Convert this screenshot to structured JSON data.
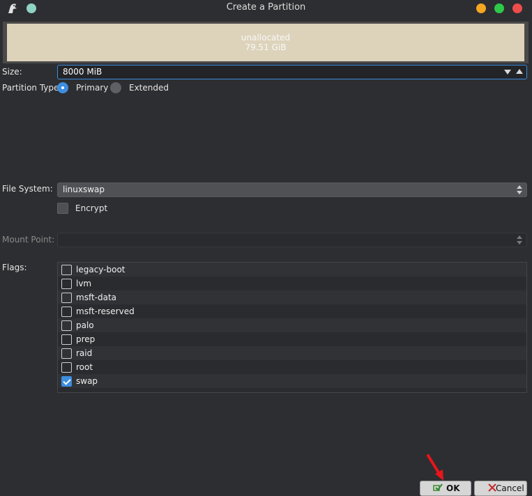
{
  "window": {
    "title": "Create a Partition",
    "controls": [
      "minimize",
      "maximize",
      "close"
    ]
  },
  "partition_graphic": {
    "name": "unallocated",
    "size": "79.51 GiB",
    "fill_color": "#ddd3bb"
  },
  "size": {
    "label": "Size:",
    "value": "8000 MiB"
  },
  "partition_type": {
    "label": "Partition Type:",
    "options": [
      "Primary",
      "Extended"
    ],
    "selected": "Primary"
  },
  "file_system": {
    "label": "File System:",
    "value": "linuxswap"
  },
  "encrypt": {
    "label": "Encrypt",
    "checked": false
  },
  "mount_point": {
    "label": "Mount Point:",
    "value": "",
    "enabled": false
  },
  "flags": {
    "label": "Flags:",
    "items": [
      {
        "label": "legacy-boot",
        "checked": false
      },
      {
        "label": "lvm",
        "checked": false
      },
      {
        "label": "msft-data",
        "checked": false
      },
      {
        "label": "msft-reserved",
        "checked": false
      },
      {
        "label": "palo",
        "checked": false
      },
      {
        "label": "prep",
        "checked": false
      },
      {
        "label": "raid",
        "checked": false
      },
      {
        "label": "root",
        "checked": false
      },
      {
        "label": "swap",
        "checked": true
      }
    ]
  },
  "buttons": {
    "ok": "OK",
    "cancel": "Cancel"
  },
  "colors": {
    "accent": "#3d8ee0",
    "background": "#2d2e31",
    "annotation_arrow": "#e8151b"
  }
}
